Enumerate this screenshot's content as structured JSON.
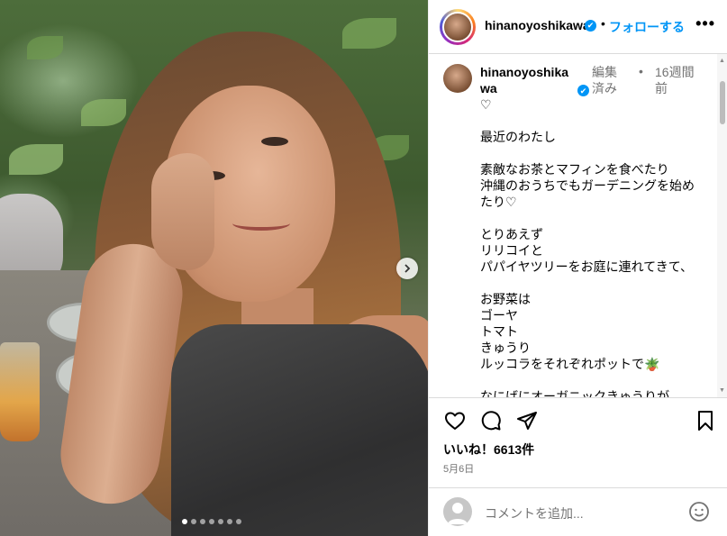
{
  "header": {
    "username": "hinanoyoshikawa",
    "verified_mark": "✔",
    "separator": "•",
    "follow_label": "フォローする",
    "more_label": "•••"
  },
  "caption": {
    "username": "hinanoyoshikawa",
    "edited": "編集済み",
    "dot": "•",
    "time": "16週間前",
    "text": "♡\n\n最近のわたし\n\n素敵なお茶とマフィンを食べたり\n沖縄のおうちでもガーデニングを始めたり♡\n\nとりあえず\nリリコイと\nパパイヤツリーをお庭に連れてきて、\n\nお野菜は\nゴーヤ\nトマト\nきゅうり\nルッコラをそれぞれポットで🪴\n\nなにげにオーガニックきゅうりが"
  },
  "actions": {
    "likes": "いいね！6613件",
    "date": "5月6日"
  },
  "comment_box": {
    "placeholder": "コメントを追加..."
  },
  "carousel": {
    "total_slides": 7,
    "active_slide": 1
  },
  "icons": {
    "heart": "heart-icon",
    "comment": "comment-icon",
    "share": "share-icon",
    "bookmark": "bookmark-icon",
    "next": "chevron-right-icon",
    "emoji": "smiley-icon"
  },
  "colors": {
    "link_blue": "#0095f6",
    "verified_blue": "#0095f6",
    "muted_text": "#737373",
    "divider": "#dbdbdb"
  }
}
